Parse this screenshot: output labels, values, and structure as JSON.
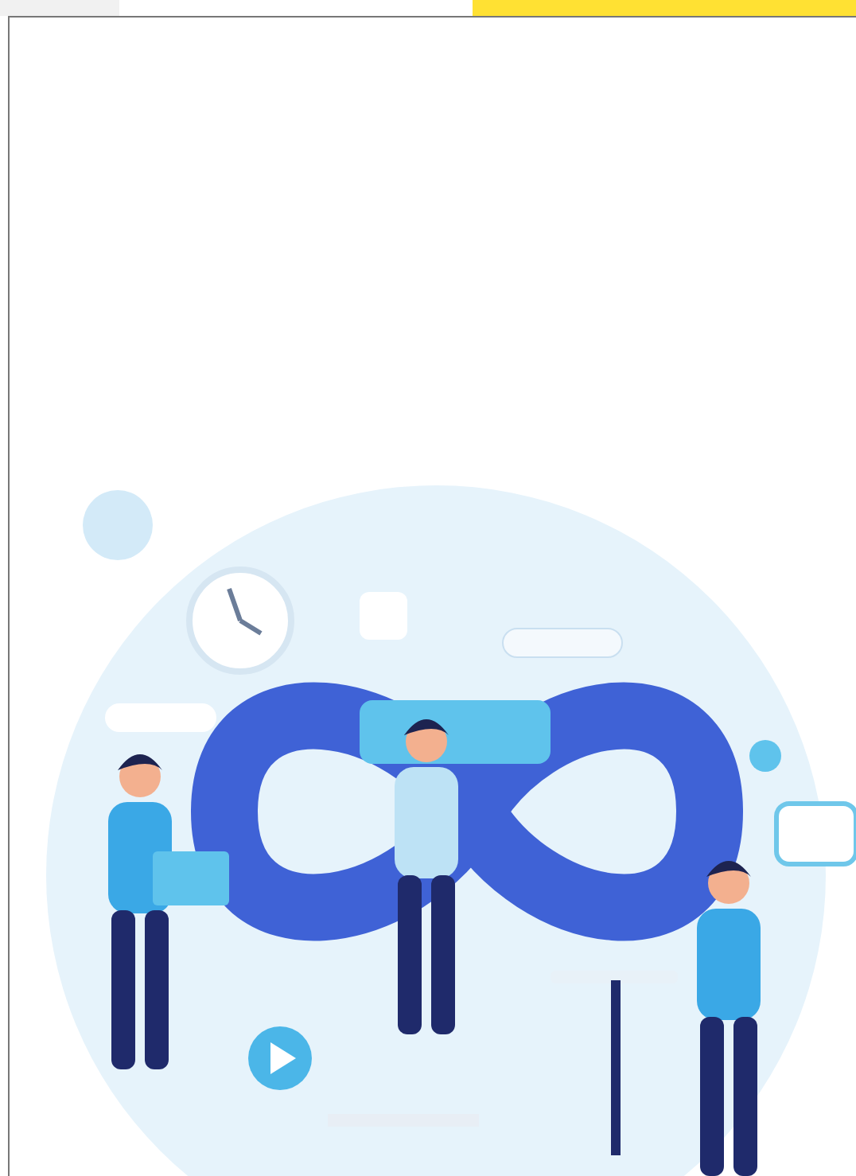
{
  "top_bar": {
    "kind": "highlighted"
  },
  "illustration": {
    "kind": "infinity-loop"
  }
}
